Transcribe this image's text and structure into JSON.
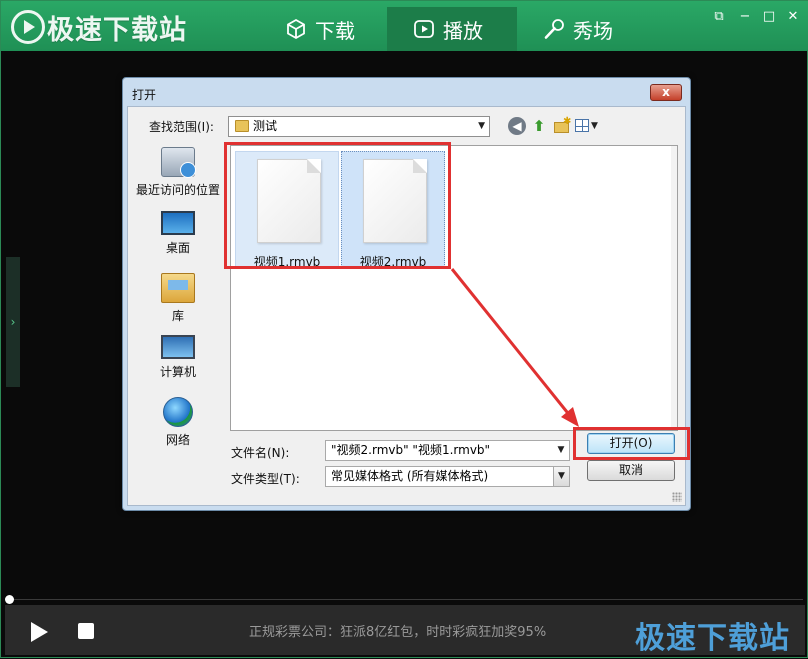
{
  "app": {
    "logo_text": "极速下载站",
    "tabs": [
      {
        "label": "下载",
        "icon": "cube-icon"
      },
      {
        "label": "播放",
        "icon": "play-icon"
      },
      {
        "label": "秀场",
        "icon": "microphone-icon"
      }
    ],
    "window_controls": [
      "restore",
      "minimize",
      "maximize",
      "close"
    ]
  },
  "dialog": {
    "title": "打开",
    "look_in_label": "查找范围(I):",
    "look_in_value": "测试",
    "places": [
      {
        "label": "最近访问的位置",
        "icon": "recent-places-icon"
      },
      {
        "label": "桌面",
        "icon": "desktop-icon"
      },
      {
        "label": "库",
        "icon": "library-icon"
      },
      {
        "label": "计算机",
        "icon": "computer-icon"
      },
      {
        "label": "网络",
        "icon": "network-icon"
      }
    ],
    "files": [
      {
        "name": "视频1.rmvb",
        "selected": true
      },
      {
        "name": "视频2.rmvb",
        "selected": true
      }
    ],
    "filename_label": "文件名(N):",
    "filename_value": "\"视频2.rmvb\" \"视频1.rmvb\"",
    "filetype_label": "文件类型(T):",
    "filetype_value": "常见媒体格式 (所有媒体格式)",
    "open_label": "打开(O)",
    "cancel_label": "取消",
    "close_label": "x"
  },
  "player": {
    "ad_text": "正规彩票公司：狂派8亿红包，时时彩疯狂加奖95%",
    "watermark": "极速下载站",
    "progress": 0
  },
  "colors": {
    "brand_green": "#25a062",
    "highlight_red": "#e03131"
  }
}
